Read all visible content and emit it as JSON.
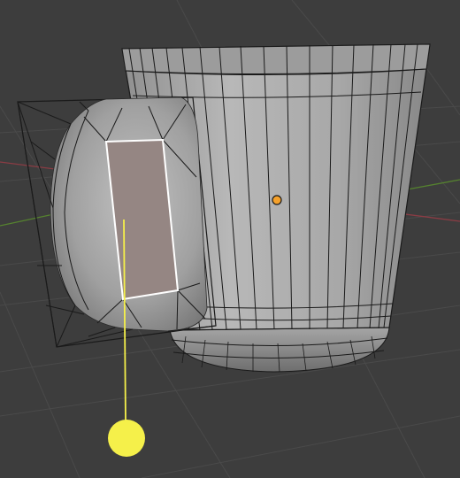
{
  "viewport": {
    "background": "#3d3d3d",
    "grid_line_color": "#4a4a4a",
    "x_axis_color": "#8a3c44",
    "y_axis_color": "#55822f"
  },
  "mesh": {
    "body_color": "#aaaaaa",
    "wire_color": "#1a1a1a",
    "selected_face_color": "#958683",
    "selected_edge_color": "#ffffff"
  },
  "origin": {
    "color": "#f5a12b"
  },
  "proportional_gizmo": {
    "color": "#f5f04a"
  }
}
